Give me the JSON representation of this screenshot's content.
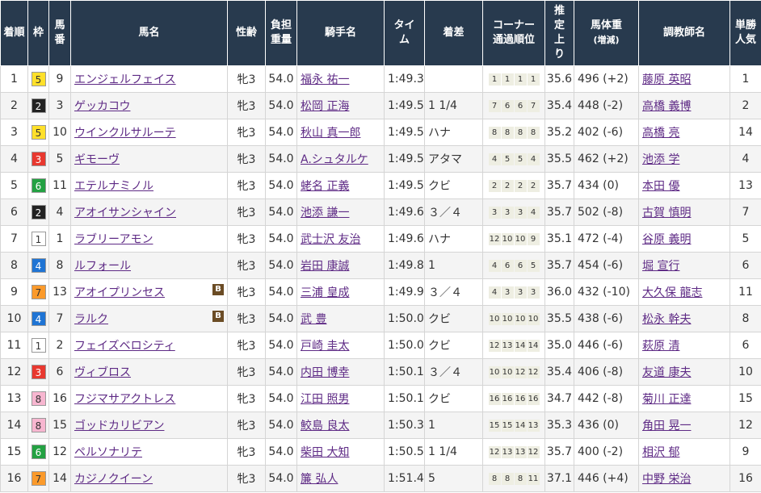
{
  "headers": {
    "rank": "着順",
    "waku": "枠",
    "umaban": "馬番",
    "horse": "馬名",
    "sexage": "性齢",
    "weight_carried": "負担重量",
    "jockey": "騎手名",
    "time": "タイム",
    "margin": "着差",
    "corner": "コーナー通過順位",
    "last3f": "推定上り",
    "body_weight": "馬体重",
    "body_weight_sub": "(増減)",
    "trainer": "調教師名",
    "popularity": "単勝人気"
  },
  "waku_colors": {
    "1": {
      "bg": "#ffffff",
      "fg": "#333333"
    },
    "2": {
      "bg": "#222222",
      "fg": "#ffffff"
    },
    "3": {
      "bg": "#e8382f",
      "fg": "#ffffff"
    },
    "4": {
      "bg": "#1f74d4",
      "fg": "#ffffff"
    },
    "5": {
      "bg": "#ffe02a",
      "fg": "#333333"
    },
    "6": {
      "bg": "#23a142",
      "fg": "#ffffff"
    },
    "7": {
      "bg": "#fb9a2b",
      "fg": "#333333"
    },
    "8": {
      "bg": "#f7b6d0",
      "fg": "#333333"
    }
  },
  "rows": [
    {
      "rank": "1",
      "waku": "5",
      "umaban": "9",
      "horse": "エンジェルフェイス",
      "blinker": "",
      "sexage": "牝3",
      "weight": "54.0",
      "jockey": "福永 祐一",
      "time": "1:49.3",
      "margin": "",
      "corner": [
        "1",
        "1",
        "1",
        "1"
      ],
      "last3f": "35.6",
      "body_weight": "496 (+2)",
      "trainer": "藤原 英昭",
      "pop": "1"
    },
    {
      "rank": "2",
      "waku": "2",
      "umaban": "3",
      "horse": "ゲッカコウ",
      "blinker": "",
      "sexage": "牝3",
      "weight": "54.0",
      "jockey": "松岡 正海",
      "time": "1:49.5",
      "margin": "1 1/4",
      "corner": [
        "7",
        "6",
        "6",
        "7"
      ],
      "last3f": "35.4",
      "body_weight": "448 (-2)",
      "trainer": "高橋 義博",
      "pop": "2"
    },
    {
      "rank": "3",
      "waku": "5",
      "umaban": "10",
      "horse": "ウインクルサルーテ",
      "blinker": "",
      "sexage": "牝3",
      "weight": "54.0",
      "jockey": "秋山 真一郎",
      "time": "1:49.5",
      "margin": "ハナ",
      "corner": [
        "8",
        "8",
        "8",
        "8"
      ],
      "last3f": "35.2",
      "body_weight": "402 (-6)",
      "trainer": "高橋 亮",
      "pop": "14"
    },
    {
      "rank": "4",
      "waku": "3",
      "umaban": "5",
      "horse": "ギモーヴ",
      "blinker": "",
      "sexage": "牝3",
      "weight": "54.0",
      "jockey": "A.シュタルケ",
      "time": "1:49.5",
      "margin": "アタマ",
      "corner": [
        "4",
        "5",
        "5",
        "4"
      ],
      "last3f": "35.5",
      "body_weight": "462 (+2)",
      "trainer": "池添 学",
      "pop": "4"
    },
    {
      "rank": "5",
      "waku": "6",
      "umaban": "11",
      "horse": "エテルナミノル",
      "blinker": "",
      "sexage": "牝3",
      "weight": "54.0",
      "jockey": "蛯名 正義",
      "time": "1:49.5",
      "margin": "クビ",
      "corner": [
        "2",
        "2",
        "2",
        "2"
      ],
      "last3f": "35.7",
      "body_weight": "434 (0)",
      "trainer": "本田 優",
      "pop": "13"
    },
    {
      "rank": "6",
      "waku": "2",
      "umaban": "4",
      "horse": "アオイサンシャイン",
      "blinker": "",
      "sexage": "牝3",
      "weight": "54.0",
      "jockey": "池添 謙一",
      "time": "1:49.6",
      "margin": "３／４",
      "corner": [
        "3",
        "3",
        "3",
        "4"
      ],
      "last3f": "35.7",
      "body_weight": "502 (-8)",
      "trainer": "古賀 慎明",
      "pop": "7"
    },
    {
      "rank": "7",
      "waku": "1",
      "umaban": "1",
      "horse": "ラブリーアモン",
      "blinker": "",
      "sexage": "牝3",
      "weight": "54.0",
      "jockey": "武士沢 友治",
      "time": "1:49.6",
      "margin": "ハナ",
      "corner": [
        "12",
        "10",
        "10",
        "9"
      ],
      "last3f": "35.1",
      "body_weight": "472 (-4)",
      "trainer": "谷原 義明",
      "pop": "5"
    },
    {
      "rank": "8",
      "waku": "4",
      "umaban": "8",
      "horse": "ルフォール",
      "blinker": "",
      "sexage": "牝3",
      "weight": "54.0",
      "jockey": "岩田 康誠",
      "time": "1:49.8",
      "margin": "1",
      "corner": [
        "4",
        "6",
        "6",
        "5"
      ],
      "last3f": "35.7",
      "body_weight": "454 (-6)",
      "trainer": "堀 宣行",
      "pop": "6"
    },
    {
      "rank": "9",
      "waku": "7",
      "umaban": "13",
      "horse": "アオイプリンセス",
      "blinker": "B",
      "sexage": "牝3",
      "weight": "54.0",
      "jockey": "三浦 皇成",
      "time": "1:49.9",
      "margin": "３／４",
      "corner": [
        "4",
        "3",
        "3",
        "3"
      ],
      "last3f": "36.0",
      "body_weight": "432 (-10)",
      "trainer": "大久保 龍志",
      "pop": "11"
    },
    {
      "rank": "10",
      "waku": "4",
      "umaban": "7",
      "horse": "ラルク",
      "blinker": "B",
      "sexage": "牝3",
      "weight": "54.0",
      "jockey": "武 豊",
      "time": "1:50.0",
      "margin": "クビ",
      "corner": [
        "10",
        "10",
        "10",
        "10"
      ],
      "last3f": "35.5",
      "body_weight": "438 (-6)",
      "trainer": "松永 幹夫",
      "pop": "8"
    },
    {
      "rank": "11",
      "waku": "1",
      "umaban": "2",
      "horse": "フェイズベロシティ",
      "blinker": "",
      "sexage": "牝3",
      "weight": "54.0",
      "jockey": "戸崎 圭太",
      "time": "1:50.0",
      "margin": "クビ",
      "corner": [
        "12",
        "13",
        "14",
        "14"
      ],
      "last3f": "35.0",
      "body_weight": "446 (-6)",
      "trainer": "萩原 清",
      "pop": "6"
    },
    {
      "rank": "12",
      "waku": "3",
      "umaban": "6",
      "horse": "ヴィブロス",
      "blinker": "",
      "sexage": "牝3",
      "weight": "54.0",
      "jockey": "内田 博幸",
      "time": "1:50.1",
      "margin": "３／４",
      "corner": [
        "10",
        "10",
        "12",
        "12"
      ],
      "last3f": "35.4",
      "body_weight": "406 (-8)",
      "trainer": "友道 康夫",
      "pop": "10"
    },
    {
      "rank": "13",
      "waku": "8",
      "umaban": "16",
      "horse": "フジマサアクトレス",
      "blinker": "",
      "sexage": "牝3",
      "weight": "54.0",
      "jockey": "江田 照男",
      "time": "1:50.1",
      "margin": "クビ",
      "corner": [
        "16",
        "16",
        "16",
        "16"
      ],
      "last3f": "34.7",
      "body_weight": "442 (-8)",
      "trainer": "菊川 正達",
      "pop": "15"
    },
    {
      "rank": "14",
      "waku": "8",
      "umaban": "15",
      "horse": "ゴッドカリビアン",
      "blinker": "",
      "sexage": "牝3",
      "weight": "54.0",
      "jockey": "鮫島 良太",
      "time": "1:50.3",
      "margin": "1",
      "corner": [
        "15",
        "15",
        "14",
        "13"
      ],
      "last3f": "35.3",
      "body_weight": "436 (0)",
      "trainer": "角田 晃一",
      "pop": "12"
    },
    {
      "rank": "15",
      "waku": "6",
      "umaban": "12",
      "horse": "ペルソナリテ",
      "blinker": "",
      "sexage": "牝3",
      "weight": "54.0",
      "jockey": "柴田 大知",
      "time": "1:50.5",
      "margin": "1 1/4",
      "corner": [
        "12",
        "13",
        "13",
        "12"
      ],
      "last3f": "35.7",
      "body_weight": "400 (-2)",
      "trainer": "相沢 郁",
      "pop": "9"
    },
    {
      "rank": "16",
      "waku": "7",
      "umaban": "14",
      "horse": "カジノクイーン",
      "blinker": "",
      "sexage": "牝3",
      "weight": "54.0",
      "jockey": "簾 弘人",
      "time": "1:51.4",
      "margin": "5",
      "corner": [
        "8",
        "8",
        "8",
        "11"
      ],
      "last3f": "37.1",
      "body_weight": "446 (+4)",
      "trainer": "中野 栄治",
      "pop": "16"
    }
  ]
}
